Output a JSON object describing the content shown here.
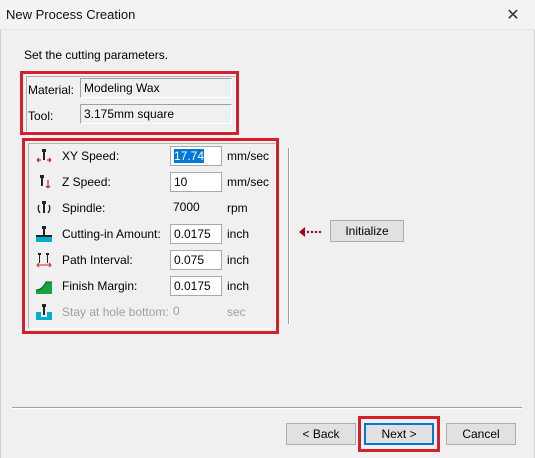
{
  "window": {
    "title": "New Process Creation",
    "close_glyph": "✕"
  },
  "instruction": "Set the cutting parameters.",
  "material": {
    "label": "Material:",
    "value": "Modeling Wax"
  },
  "tool": {
    "label": "Tool:",
    "value": "3.175mm square"
  },
  "params": [
    {
      "icon": "xy-speed-icon",
      "label": "XY Speed:",
      "value": "17.74",
      "unit": "mm/sec"
    },
    {
      "icon": "z-speed-icon",
      "label": "Z Speed:",
      "value": "10",
      "unit": "mm/sec"
    },
    {
      "icon": "spindle-icon",
      "label": "Spindle:",
      "value": "7000",
      "unit": "rpm"
    },
    {
      "icon": "cutting-in-amount-icon",
      "label": "Cutting-in Amount:",
      "value": "0.0175",
      "unit": "inch"
    },
    {
      "icon": "path-interval-icon",
      "label": "Path Interval:",
      "value": "0.075",
      "unit": "inch"
    },
    {
      "icon": "finish-margin-icon",
      "label": "Finish Margin:",
      "value": "0.0175",
      "unit": "inch"
    },
    {
      "icon": "stay-at-hole-bottom-icon",
      "label": "Stay at hole bottom:",
      "value": "0",
      "unit": "sec"
    }
  ],
  "buttons": {
    "initialize": "Initialize",
    "back": "< Back",
    "next": "Next >",
    "cancel": "Cancel"
  },
  "colors": {
    "highlight": "#d4202a",
    "accent": "#0078d7",
    "icon_cyan": "#00b0c8",
    "icon_green": "#1aa33a",
    "arrow_red": "#b0001a"
  }
}
